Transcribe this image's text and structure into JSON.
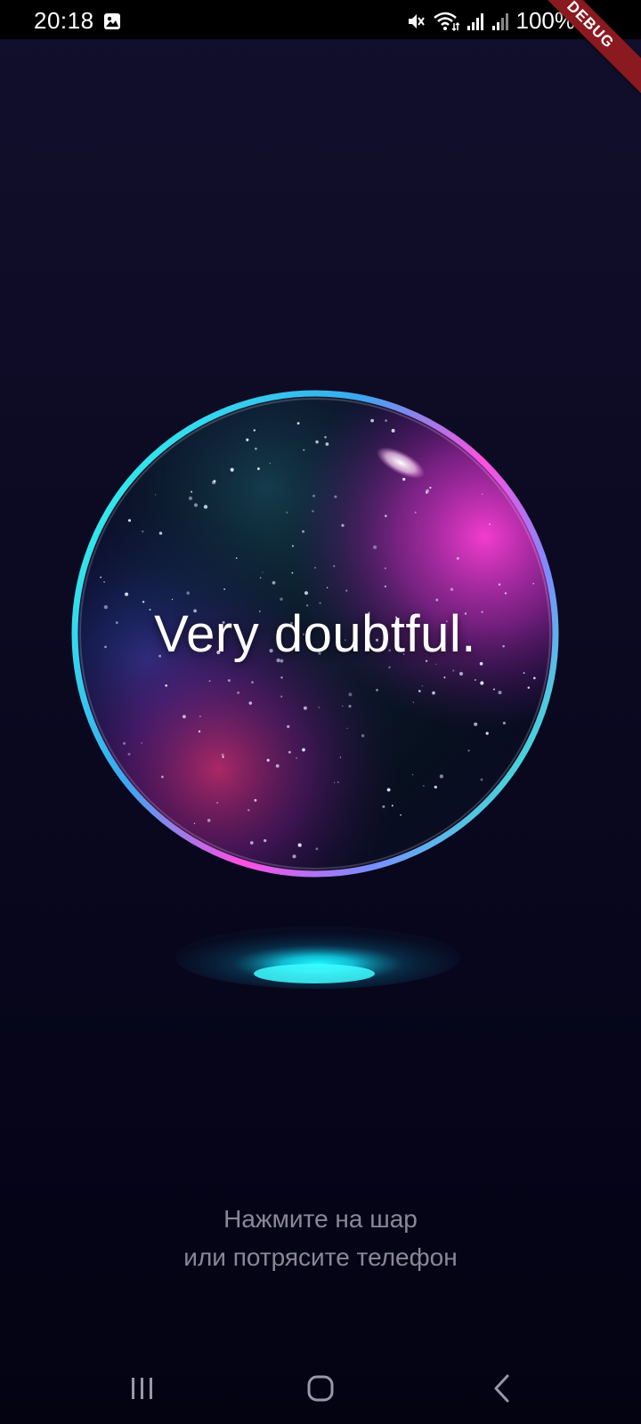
{
  "status_bar": {
    "time": "20:18",
    "battery": "100%",
    "icons": [
      "gallery-icon",
      "mute-icon",
      "wifi-icon",
      "signal-icon",
      "signal-icon-2",
      "battery-icon"
    ]
  },
  "debug_banner": "DEBUG",
  "orb": {
    "answer": "Very doubtful."
  },
  "hint": {
    "line1": "Нажмите на шар",
    "line2": "или потрясите телефон"
  },
  "nav": {
    "recents": "recents-icon",
    "home": "home-icon",
    "back": "back-icon"
  },
  "colors": {
    "background": "#0c0a22",
    "orb_rim_cyan": "#2ff5e8",
    "orb_rim_magenta": "#ff3fd8",
    "hint_text": "#8a8797",
    "debug_banner": "#8a1a20"
  }
}
